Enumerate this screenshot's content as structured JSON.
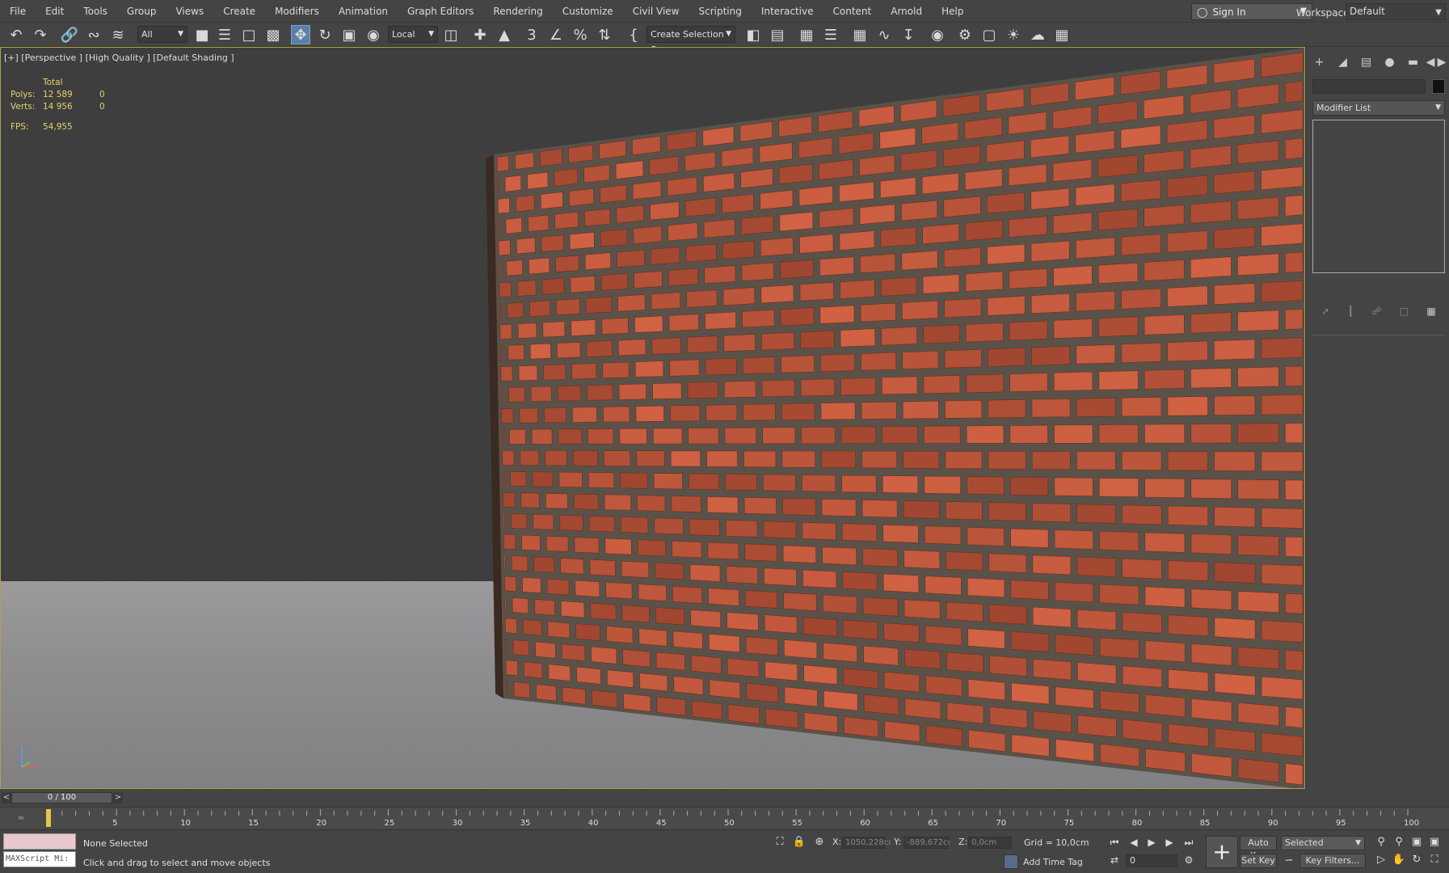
{
  "menu": [
    "File",
    "Edit",
    "Tools",
    "Group",
    "Views",
    "Create",
    "Modifiers",
    "Animation",
    "Graph Editors",
    "Rendering",
    "Customize",
    "Civil View",
    "Scripting",
    "Interactive",
    "Content",
    "Arnold",
    "Help"
  ],
  "signin": "Sign In",
  "workspaces": {
    "label": "Workspaces:",
    "value": "Default"
  },
  "toolbar": {
    "filter": "All",
    "ref_coord": "Local",
    "selection_set": "Create Selection Se"
  },
  "viewport": {
    "label": "[+] [Perspective ] [High Quality ] [Default Shading ]",
    "stats": {
      "header": "Total",
      "polys_label": "Polys:",
      "polys_value": "12 589",
      "polys_sel": "0",
      "verts_label": "Verts:",
      "verts_value": "14 956",
      "verts_sel": "0",
      "fps_label": "FPS:",
      "fps_value": "54,955"
    }
  },
  "command_panel": {
    "modifier_list": "Modifier List"
  },
  "timeline": {
    "slider": "0 / 100",
    "ticks": [
      "5",
      "10",
      "15",
      "20",
      "25",
      "30",
      "35",
      "40",
      "45",
      "50",
      "55",
      "60",
      "65",
      "70",
      "75",
      "80",
      "85",
      "90",
      "95",
      "100"
    ],
    "start": 0,
    "end": 100
  },
  "status": {
    "maxscript": "MAXScript Mi:",
    "selection": "None Selected",
    "prompt": "Click and drag to select and move objects",
    "x_label": "X:",
    "x_value": "1050,228cı",
    "y_label": "Y:",
    "y_value": "-889,672cı",
    "z_label": "Z:",
    "z_value": "0,0cm",
    "grid": "Grid = 10,0cm",
    "add_time_tag": "Add Time Tag",
    "frame": "0",
    "auto_key": "Auto Key",
    "set_key": "Set Key",
    "selected": "Selected",
    "key_filters": "Key Filters..."
  },
  "colors": {
    "viewport_border": "#b1a14c",
    "stats_text": "#e6d36a",
    "active_tool": "#5b7fa6",
    "brick": "#b4533a",
    "mortar": "#5a5249"
  }
}
